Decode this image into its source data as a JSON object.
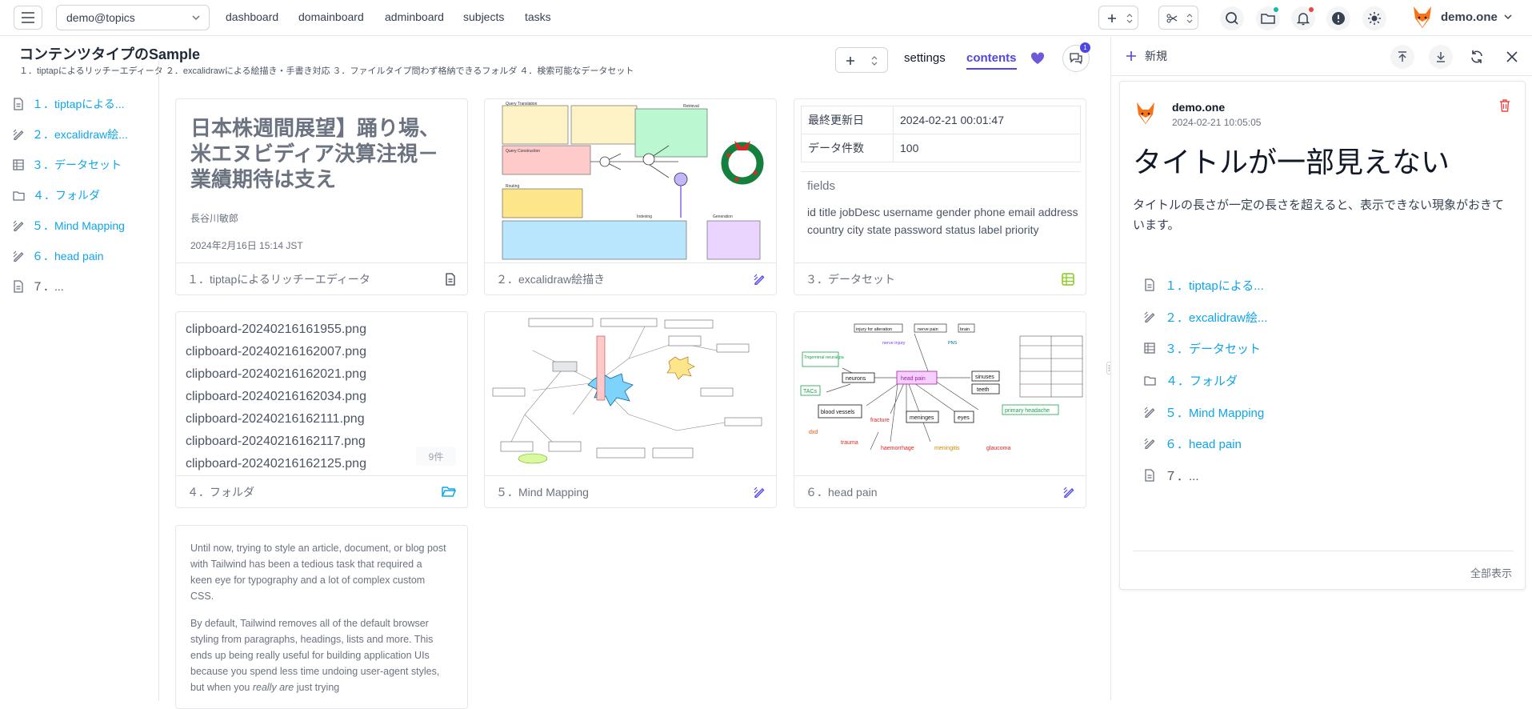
{
  "topbar": {
    "workspace": "demo@topics",
    "nav": [
      "dashboard",
      "domainboard",
      "adminboard",
      "subjects",
      "tasks"
    ],
    "user": "demo.one",
    "colors": {
      "notify_dot": "#ef4444",
      "files_dot": "#14b8a6"
    }
  },
  "header": {
    "title": "コンテンツタイプのSample",
    "subtitle": "１．tiptapによるリッチーエディータ ２．excalidrawによる絵描き・手書き対応 ３．ファイルタイプ問わず格納できるフォルダ ４．検索可能なデータセット",
    "tab_settings": "settings",
    "tab_contents": "contents",
    "comment_count": "1"
  },
  "sidebar": {
    "items": [
      {
        "label": "１．tiptapによる...",
        "icon": "document-icon"
      },
      {
        "label": "２．excalidraw絵...",
        "icon": "draw-icon"
      },
      {
        "label": "３．データセット",
        "icon": "table-icon"
      },
      {
        "label": "４．フォルダ",
        "icon": "folder-icon"
      },
      {
        "label": "５．Mind Mapping",
        "icon": "draw-icon"
      },
      {
        "label": "６．head pain",
        "icon": "draw-icon"
      },
      {
        "label": "７．...",
        "icon": "document-icon"
      }
    ]
  },
  "cards": {
    "article": {
      "headline": "日本株週間展望】踊り場、米エヌビディア決算注視－業績期待は支え",
      "author": "長谷川敏郎",
      "date": "2024年2月16日 15:14 JST",
      "footer": "１．tiptapによるリッチーエディータ"
    },
    "excalidraw": {
      "footer": "２．excalidraw絵描き",
      "diagram_labels": [
        "Query Translation",
        "Retrieval",
        "Routing",
        "Query Construction",
        "Indexing",
        "Generation"
      ]
    },
    "dataset": {
      "row1_key": "最終更新日",
      "row1_val": "2024-02-21 00:01:47",
      "row2_key": "データ件数",
      "row2_val": "100",
      "fields_label": "fields",
      "fields": "id title jobDesc username gender phone email address country city state password status label priority",
      "footer": "３．データセット"
    },
    "folder": {
      "files": [
        "clipboard-20240216161955.png",
        "clipboard-20240216162007.png",
        "clipboard-20240216162021.png",
        "clipboard-20240216162034.png",
        "clipboard-20240216162111.png",
        "clipboard-20240216162117.png",
        "clipboard-20240216162125.png"
      ],
      "count": "9件",
      "footer": "４．フォルダ"
    },
    "mindmap": {
      "footer": "５．Mind Mapping"
    },
    "headpain": {
      "footer": "６．head pain",
      "nodes": [
        "head pain",
        "Trigeminal neuralgia",
        "TACs",
        "neurons",
        "blood vessels",
        "fracture",
        "trauma",
        "haemorrhage",
        "meninges",
        "meningitis",
        "eyes",
        "glaucoma",
        "sinuses",
        "teeth",
        "primary headache",
        "injury for alteration",
        "nerve pain",
        "brain",
        "nerve injury",
        "PNS",
        "dxd"
      ]
    },
    "prose": {
      "p1": "Until now, trying to style an article, document, or blog post with Tailwind has been a tedious task that required a keen eye for typography and a lot of complex custom CSS.",
      "p2a": "By default, Tailwind removes all of the default browser styling from paragraphs, headings, lists and more. This ends up being really useful for building application UIs because you spend less time undoing user-agent styles, but when you ",
      "p2em": "really are",
      "p2b": " just trying"
    }
  },
  "panel": {
    "new_label": "新規",
    "author": "demo.one",
    "timestamp": "2024-02-21 10:05:05",
    "title": "タイトルが一部見えない",
    "body": "タイトルの長さが一定の長さを超えると、表示できない現象がおきています。",
    "items": [
      {
        "label": "１．tiptapによる...",
        "icon": "document-icon"
      },
      {
        "label": "２．excalidraw絵...",
        "icon": "draw-icon"
      },
      {
        "label": "３．データセット",
        "icon": "table-icon"
      },
      {
        "label": "４．フォルダ",
        "icon": "folder-icon"
      },
      {
        "label": "５．Mind Mapping",
        "icon": "draw-icon"
      },
      {
        "label": "６．head pain",
        "icon": "draw-icon"
      },
      {
        "label": "７．...",
        "icon": "document-icon"
      }
    ],
    "show_all": "全部表示"
  }
}
